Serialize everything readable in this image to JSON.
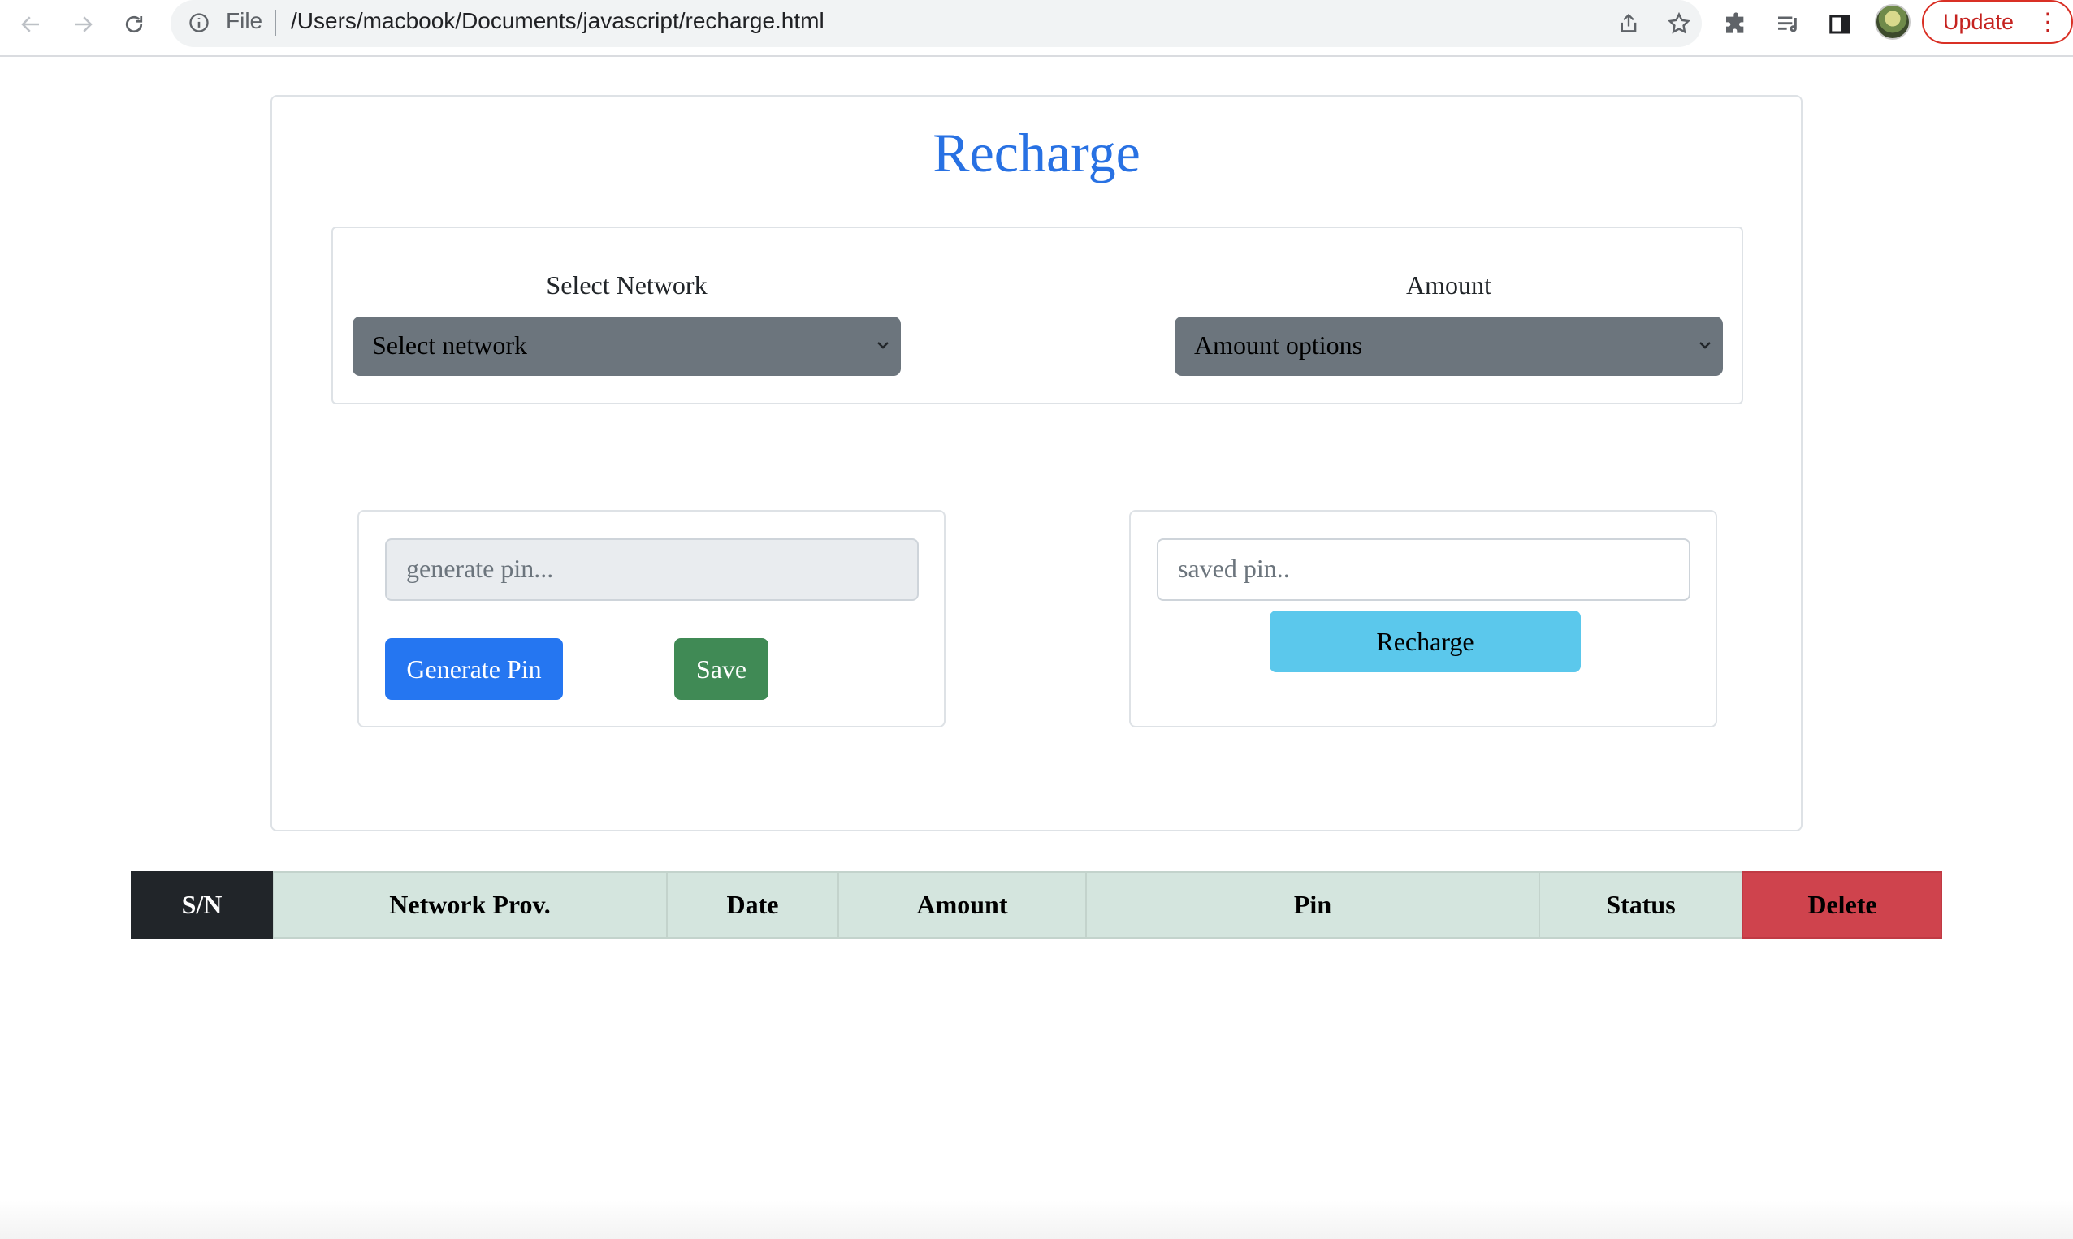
{
  "browser": {
    "scheme_label": "File",
    "url": "/Users/macbook/Documents/javascript/recharge.html",
    "update_label": "Update"
  },
  "page": {
    "title": "Recharge",
    "network": {
      "label": "Select Network",
      "selected": "Select network"
    },
    "amount": {
      "label": "Amount",
      "selected": "Amount options"
    },
    "generate": {
      "placeholder": "generate pin...",
      "generate_label": "Generate Pin",
      "save_label": "Save"
    },
    "recharge": {
      "placeholder": "saved pin..",
      "button_label": "Recharge"
    }
  },
  "table": {
    "headers": [
      "S/N",
      "Network Prov.",
      "Date",
      "Amount",
      "Pin",
      "Status",
      "Delete"
    ]
  },
  "colors": {
    "title": "#2871e3",
    "select_bg": "#6c757d",
    "primary": "#2576f1",
    "success": "#408a55",
    "info": "#5bc8ec",
    "table_header": "#d4e5de",
    "dark": "#212529",
    "danger": "#cf434d"
  }
}
